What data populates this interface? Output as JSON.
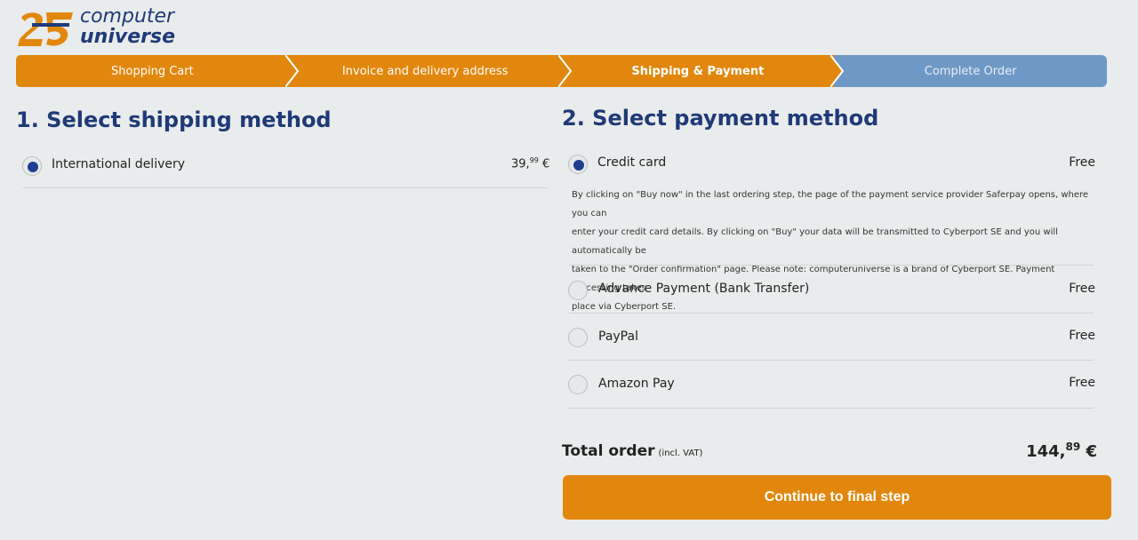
{
  "brand": {
    "line1": "computer",
    "line2": "universe",
    "logo_icon": "25-anniversary-logo",
    "color_orange": "#e2870d",
    "color_blue": "#1f3a78"
  },
  "steps": [
    {
      "label": "Shopping Cart",
      "state": "done"
    },
    {
      "label": "Invoice and delivery address",
      "state": "done"
    },
    {
      "label": "Shipping & Payment",
      "state": "current"
    },
    {
      "label": "Complete Order",
      "state": "todo"
    }
  ],
  "shipping": {
    "heading": "1. Select shipping method",
    "options": [
      {
        "label": "International delivery",
        "price_main": "39,",
        "price_cents": "99",
        "currency": " €",
        "selected": true
      }
    ]
  },
  "payment": {
    "heading": "2. Select payment method",
    "options": [
      {
        "label": "Credit card",
        "price": "Free",
        "selected": true
      },
      {
        "label": "Advance Payment (Bank Transfer)",
        "price": "Free",
        "selected": false
      },
      {
        "label": "PayPal",
        "price": "Free",
        "selected": false
      },
      {
        "label": "Amazon Pay",
        "price": "Free",
        "selected": false
      }
    ],
    "credit_card_description": [
      "By clicking on \"Buy now\" in the last ordering step, the page of the payment service provider Saferpay opens, where you can",
      "enter your credit card details. By clicking on \"Buy\" your data will be transmitted to Cyberport SE and you will automatically be",
      "taken to the \"Order confirmation\" page. Please note: computeruniverse is a brand of Cyberport SE. Payment processing takes",
      "place via Cyberport SE."
    ]
  },
  "total": {
    "label": "Total order",
    "note": "(incl. VAT)",
    "value_main": "144,",
    "value_cents": "89",
    "currency": " €"
  },
  "continue_label": "Continue to final step"
}
